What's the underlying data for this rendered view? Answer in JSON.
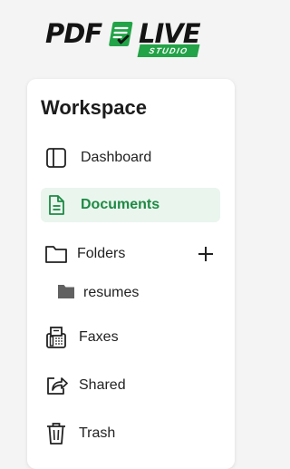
{
  "logo": {
    "left_text": "PDF",
    "right_text": "LIVE",
    "badge": "STUDIO",
    "accent": "#22a347",
    "icon": "document-check-icon"
  },
  "workspace": {
    "title": "Workspace"
  },
  "nav": [
    {
      "label": "Dashboard",
      "icon": "sidebar-panel-icon",
      "active": false
    },
    {
      "label": "Documents",
      "icon": "document-icon",
      "active": true
    },
    {
      "label": "Folders",
      "icon": "folder-outline-icon",
      "active": false
    },
    {
      "label": "Faxes",
      "icon": "fax-icon",
      "active": false
    },
    {
      "label": "Shared",
      "icon": "share-icon",
      "active": false
    },
    {
      "label": "Trash",
      "icon": "trash-icon",
      "active": false
    }
  ],
  "folders": {
    "add_icon": "plus-icon",
    "items": [
      {
        "label": "resumes",
        "icon": "folder-filled-icon"
      }
    ]
  },
  "colors": {
    "active_bg": "#eaf5ee",
    "active_text": "#1e8a44"
  }
}
